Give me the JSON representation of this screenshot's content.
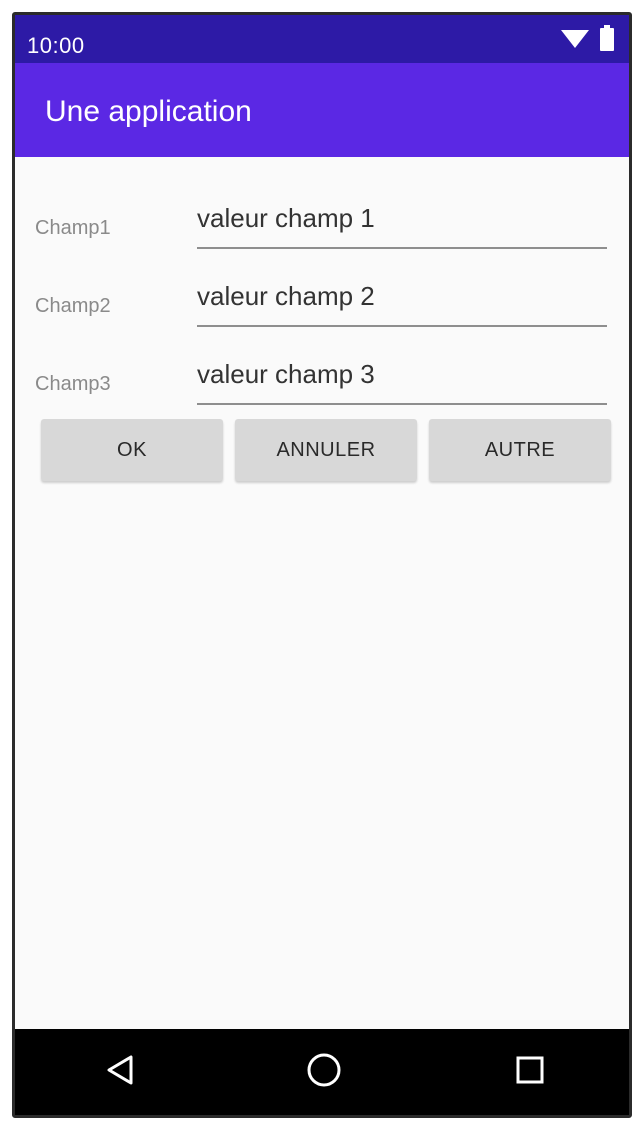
{
  "status_bar": {
    "time": "10:00",
    "icons": [
      "wifi-icon",
      "battery-icon"
    ],
    "color": "#2d1aa6"
  },
  "app_bar": {
    "title": "Une application",
    "color": "#5b28e4"
  },
  "form": {
    "fields": [
      {
        "label": "Champ1",
        "value": "valeur champ 1"
      },
      {
        "label": "Champ2",
        "value": "valeur champ 2"
      },
      {
        "label": "Champ3",
        "value": "valeur champ 3"
      }
    ],
    "buttons": [
      {
        "label": "OK"
      },
      {
        "label": "ANNULER"
      },
      {
        "label": "AUTRE"
      }
    ]
  },
  "nav_bar": {
    "icons": [
      "back-icon",
      "home-icon",
      "recents-icon"
    ]
  }
}
